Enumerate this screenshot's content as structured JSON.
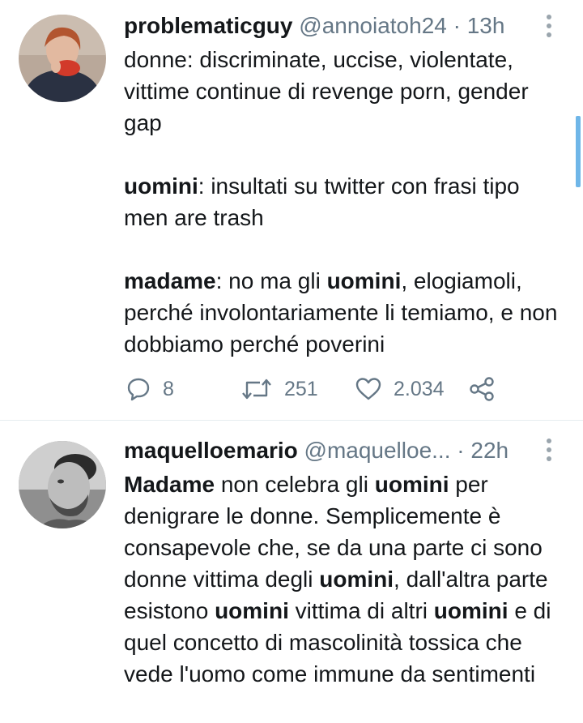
{
  "tweets": [
    {
      "display_name": "problematicguy",
      "handle": "@annoiatoh24",
      "separator": "·",
      "time": "13h",
      "paragraphs": [
        [
          {
            "text": "donne: discriminate, uccise, violentate, vittime continue di revenge porn, gender gap",
            "bold": false
          }
        ],
        [
          {
            "text": "uomini",
            "bold": true
          },
          {
            "text": ": insultati su twitter con frasi tipo men are trash",
            "bold": false
          }
        ],
        [
          {
            "text": "madame",
            "bold": true
          },
          {
            "text": ": no ma gli ",
            "bold": false
          },
          {
            "text": "uomini",
            "bold": true
          },
          {
            "text": ", elogiamoli, perché involontariamente li temiamo, e non dobbiamo perché poverini",
            "bold": false
          }
        ]
      ],
      "actions": {
        "replies": "8",
        "retweets": "251",
        "likes": "2.034"
      }
    },
    {
      "display_name": "maquelloemario",
      "handle": "@maquelloe...",
      "separator": "·",
      "time": "22h",
      "paragraphs": [
        [
          {
            "text": "Madame",
            "bold": true
          },
          {
            "text": " non celebra gli ",
            "bold": false
          },
          {
            "text": "uomini",
            "bold": true
          },
          {
            "text": " per denigrare le donne. Semplicemente è consapevole che, se da una parte ci sono donne vittima degli ",
            "bold": false
          },
          {
            "text": "uomini",
            "bold": true
          },
          {
            "text": ", dall'altra parte esistono ",
            "bold": false
          },
          {
            "text": "uomini",
            "bold": true
          },
          {
            "text": " vittima di altri ",
            "bold": false
          },
          {
            "text": "uomini",
            "bold": true
          },
          {
            "text": " e di quel concetto di mascolinità tossica che vede l'uomo come immune da sentimenti",
            "bold": false
          }
        ]
      ]
    }
  ],
  "icons": {
    "reply": "reply-icon",
    "retweet": "retweet-icon",
    "like": "heart-icon",
    "share": "share-icon",
    "more": "more-vertical-icon"
  },
  "colors": {
    "text": "#14171a",
    "secondary": "#657786",
    "divider": "#e6ecf0",
    "scrollbar": "#6fb6e8"
  }
}
